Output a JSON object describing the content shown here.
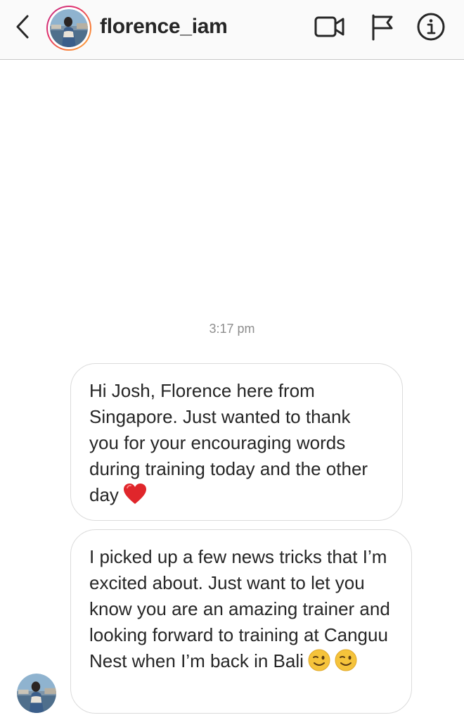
{
  "header": {
    "username": "florence_iam",
    "back_icon": "chevron-left-icon",
    "video_icon": "video-camera-icon",
    "flag_icon": "flag-icon",
    "info_icon": "info-icon"
  },
  "conversation": {
    "timestamp": "3:17 pm",
    "messages": [
      {
        "text": "Hi Josh, Florence here from Singapore. Just wanted to thank you for your encouraging words during training today and the other day",
        "emoji": "red-heart-icon"
      },
      {
        "text": "I picked up a few news tricks that I’m excited about. Just want to let you know you are an amazing trainer and looking forward to training at Canguu Nest when I’m back in Bali",
        "emoji": "winking-face-icon"
      }
    ]
  },
  "colors": {
    "header_bg": "#fafafa",
    "divider": "#c8c8c8",
    "bubble_border": "#dbdbdb",
    "text": "#262626",
    "timestamp": "#8e8e8e",
    "heart": "#e0262b",
    "emoji_face": "#f5c33b"
  }
}
